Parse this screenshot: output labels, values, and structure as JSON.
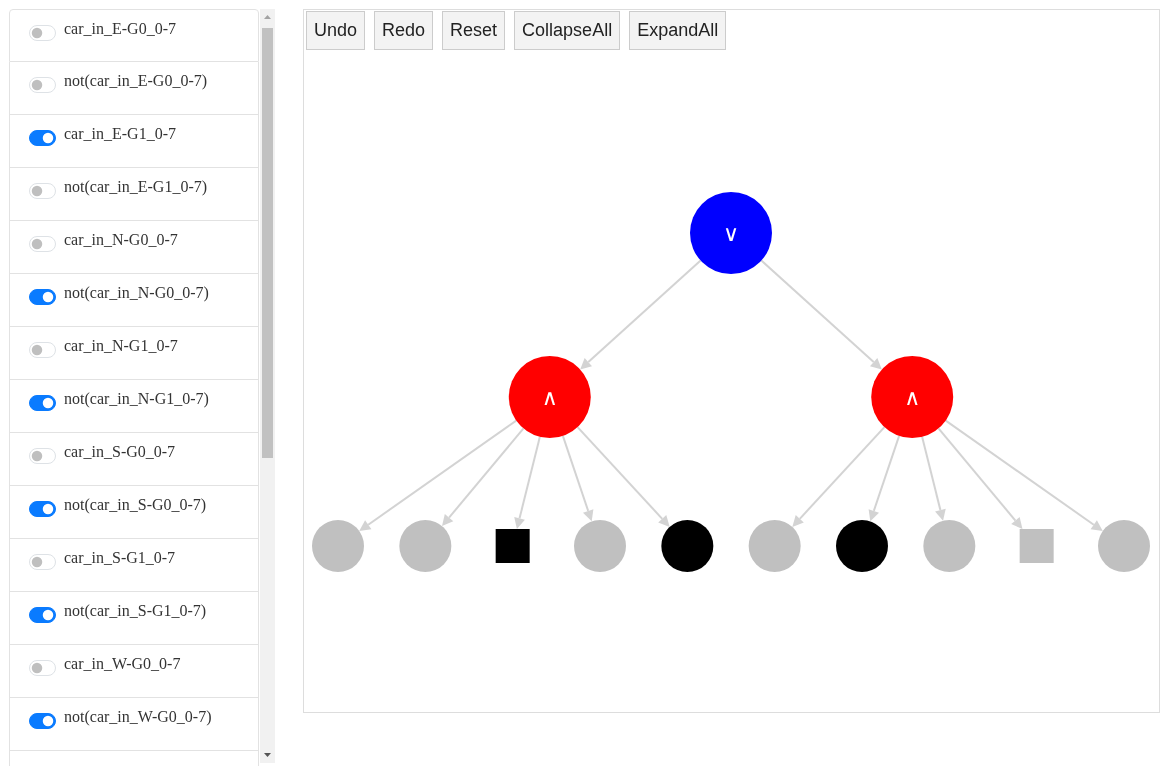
{
  "toggles": [
    {
      "label": "car_in_E-G0_0-7",
      "on": false
    },
    {
      "label": "not(car_in_E-G0_0-7)",
      "on": false
    },
    {
      "label": "car_in_E-G1_0-7",
      "on": true
    },
    {
      "label": "not(car_in_E-G1_0-7)",
      "on": false
    },
    {
      "label": "car_in_N-G0_0-7",
      "on": false
    },
    {
      "label": "not(car_in_N-G0_0-7)",
      "on": true
    },
    {
      "label": "car_in_N-G1_0-7",
      "on": false
    },
    {
      "label": "not(car_in_N-G1_0-7)",
      "on": true
    },
    {
      "label": "car_in_S-G0_0-7",
      "on": false
    },
    {
      "label": "not(car_in_S-G0_0-7)",
      "on": true
    },
    {
      "label": "car_in_S-G1_0-7",
      "on": false
    },
    {
      "label": "not(car_in_S-G1_0-7)",
      "on": true
    },
    {
      "label": "car_in_W-G0_0-7",
      "on": false
    },
    {
      "label": "not(car_in_W-G0_0-7)",
      "on": true
    }
  ],
  "toolbar": {
    "buttons": [
      "Undo",
      "Redo",
      "Reset",
      "CollapseAll",
      "ExpandAll"
    ]
  },
  "tree": {
    "kind": "circle",
    "label": "∨",
    "color": "#0000ff",
    "children": [
      {
        "kind": "circle",
        "label": "∧",
        "color": "#ff0000",
        "children": [
          {
            "kind": "circle",
            "color": "#c0c0c0"
          },
          {
            "kind": "circle",
            "color": "#c0c0c0"
          },
          {
            "kind": "square",
            "color": "#000000"
          },
          {
            "kind": "circle",
            "color": "#c0c0c0"
          },
          {
            "kind": "circle",
            "color": "#000000"
          }
        ]
      },
      {
        "kind": "circle",
        "label": "∧",
        "color": "#ff0000",
        "children": [
          {
            "kind": "circle",
            "color": "#c0c0c0"
          },
          {
            "kind": "circle",
            "color": "#000000"
          },
          {
            "kind": "circle",
            "color": "#c0c0c0"
          },
          {
            "kind": "square",
            "color": "#c0c0c0"
          },
          {
            "kind": "circle",
            "color": "#c0c0c0"
          }
        ]
      }
    ]
  }
}
